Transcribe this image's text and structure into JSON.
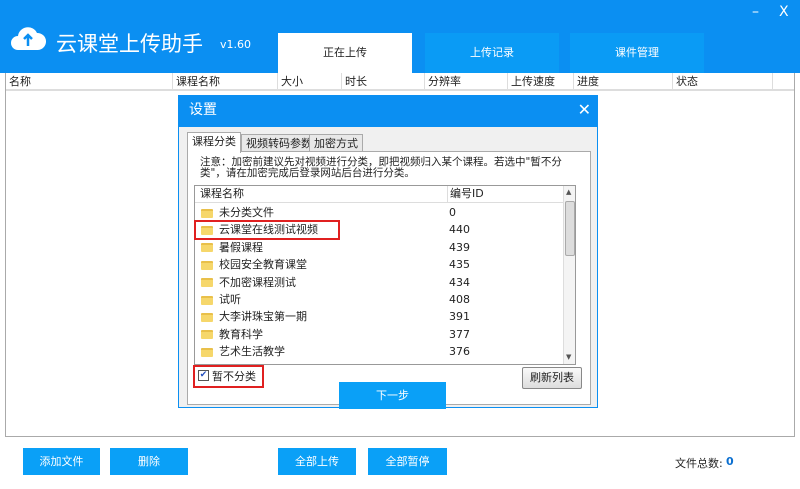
{
  "app": {
    "title": "云课堂上传助手",
    "version": "v1.60",
    "minimize": "–",
    "close": "X"
  },
  "tabs": [
    {
      "label": "正在上传",
      "active": true
    },
    {
      "label": "上传记录"
    },
    {
      "label": "课件管理"
    }
  ],
  "table": {
    "columns": [
      "名称",
      "课程名称",
      "大小",
      "时长",
      "分辨率",
      "上传速度",
      "进度",
      "状态"
    ]
  },
  "bottom": {
    "add": "添加文件",
    "delete": "删除",
    "upload_all": "全部上传",
    "pause_all": "全部暂停",
    "total_label": "文件总数:",
    "total_value": "0"
  },
  "dialog": {
    "title": "设置",
    "close": "✕",
    "tabs": [
      "课程分类",
      "视频转码参数",
      "加密方式"
    ],
    "notice": "注意：加密前建议先对视频进行分类，即把视频归入某个课程。若选中\"暂不分类\"，请在加密完成后登录网站后台进行分类。",
    "list_headers": [
      "课程名称",
      "编号ID"
    ],
    "rows": [
      {
        "name": "未分类文件",
        "id": "0"
      },
      {
        "name": "云课堂在线测试视频",
        "id": "440"
      },
      {
        "name": "暑假课程",
        "id": "439"
      },
      {
        "name": "校园安全教育课堂",
        "id": "435"
      },
      {
        "name": "不加密课程测试",
        "id": "434"
      },
      {
        "name": "试听",
        "id": "408"
      },
      {
        "name": "大李讲珠宝第一期",
        "id": "391"
      },
      {
        "name": "教育科学",
        "id": "377"
      },
      {
        "name": "艺术生活教学",
        "id": "376"
      }
    ],
    "checkbox_label": "暂不分类",
    "checkbox_checked": true,
    "refresh": "刷新列表",
    "next": "下一步"
  },
  "colors": {
    "brand": "#0b8ff2",
    "button": "#0aa0f7",
    "highlight": "#e02020"
  }
}
